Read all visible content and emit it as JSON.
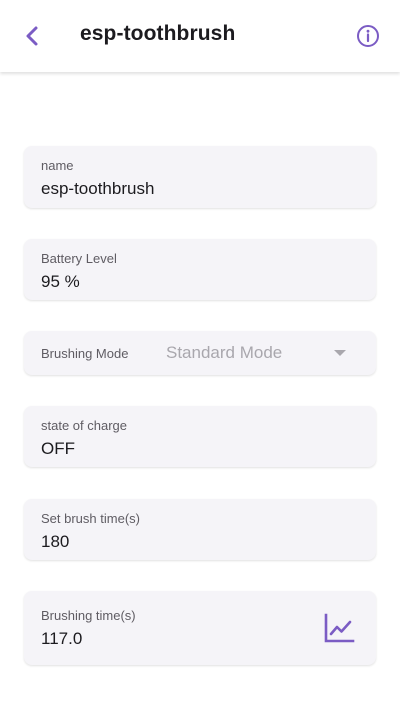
{
  "header": {
    "title": "esp-toothbrush",
    "back_icon": "chevron-left-icon",
    "info_icon": "info-circle-icon"
  },
  "accent_color": "#7b5cc4",
  "fields": {
    "name": {
      "label": "name",
      "value": "esp-toothbrush"
    },
    "battery": {
      "label": "Battery Level",
      "value": "95 %"
    },
    "mode": {
      "label": "Brushing Mode",
      "selected": "Standard Mode"
    },
    "charge": {
      "label": "state of charge",
      "value": "OFF"
    },
    "brush_time": {
      "label": "Set brush time(s)",
      "value": "180"
    },
    "brushing_time": {
      "label": "Brushing time(s)",
      "value": "117.0",
      "icon": "line-chart-icon"
    }
  }
}
